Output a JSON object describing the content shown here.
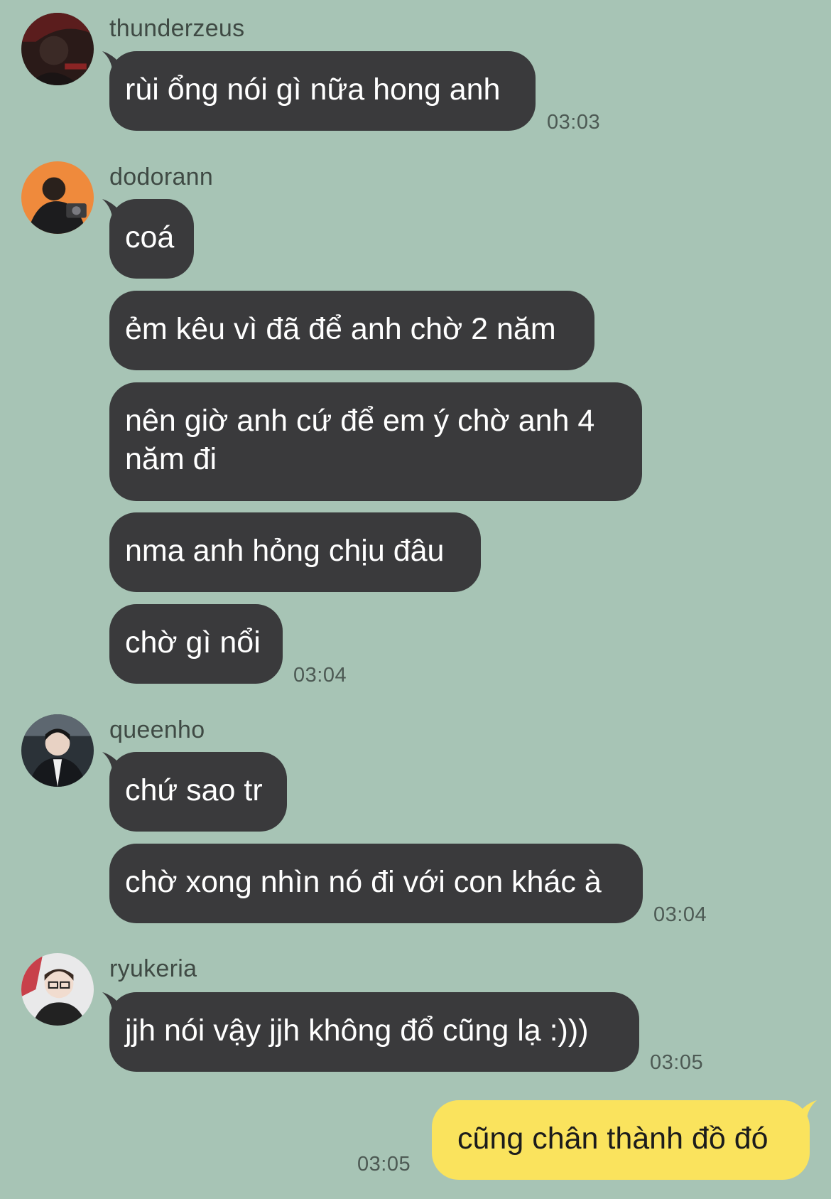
{
  "colors": {
    "background": "#a7c4b5",
    "incoming_bubble": "#3a3a3c",
    "outgoing_bubble": "#fae35d"
  },
  "groups": [
    {
      "sender": "thunderzeus",
      "avatar": "user-avatar-thunderzeus",
      "messages": [
        "rùi ổng nói gì nữa hong anh"
      ],
      "time": "03:03"
    },
    {
      "sender": "dodorann",
      "avatar": "user-avatar-dodorann",
      "messages": [
        "coá",
        "ẻm kêu vì đã để anh chờ 2 năm",
        "nên giờ anh cứ để em ý chờ anh 4 năm đi",
        "nma anh hỏng chịu đâu",
        "chờ gì nổi"
      ],
      "time": "03:04"
    },
    {
      "sender": "queenho",
      "avatar": "user-avatar-queenho",
      "messages": [
        "chứ sao tr",
        "chờ xong nhìn nó đi với con khác à"
      ],
      "time": "03:04"
    },
    {
      "sender": "ryukeria",
      "avatar": "user-avatar-ryukeria",
      "messages": [
        "jjh nói vậy jjh không đổ cũng lạ :)))"
      ],
      "time": "03:05"
    }
  ],
  "outgoing": {
    "message": "cũng chân thành đồ đó",
    "time": "03:05"
  }
}
